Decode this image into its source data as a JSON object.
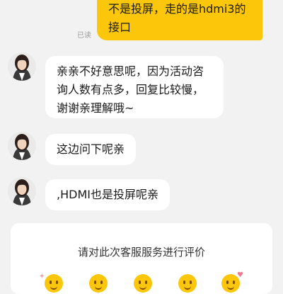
{
  "chat": {
    "my_message": "不是投屏，走的是hdmi3的接口",
    "read_status": "已读",
    "agent_messages": [
      "亲亲不好意思呢，因为活动咨询人数有点多，回复比较慢，谢谢亲理解哦~",
      "这边问下呢亲",
      ",HDMI也是投屏呢亲"
    ]
  },
  "review": {
    "title": "请对此次客服服务进行评价",
    "options": [
      "rating-1-icon",
      "rating-2-icon",
      "rating-3-icon",
      "rating-4-icon",
      "rating-5-icon"
    ]
  },
  "colors": {
    "my_bubble": "#fcc70a",
    "agent_bubble": "#ffffff",
    "background": "#f2f2f2"
  }
}
